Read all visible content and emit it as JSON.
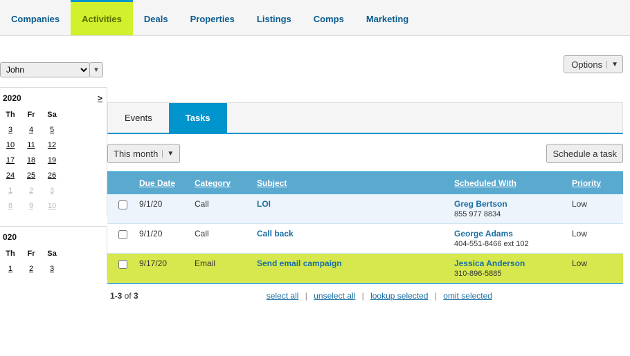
{
  "nav": {
    "items": [
      "Companies",
      "Activities",
      "Deals",
      "Properties",
      "Listings",
      "Comps",
      "Marketing"
    ],
    "active": 1
  },
  "user_selector": {
    "value": "John"
  },
  "options_button": "Options",
  "subtabs": {
    "items": [
      "Events",
      "Tasks"
    ],
    "active": 1
  },
  "filter": {
    "label": "This month"
  },
  "schedule_button": "Schedule a task",
  "grid": {
    "headers": {
      "due": "Due Date",
      "cat": "Category",
      "sub": "Subject",
      "sched": "Scheduled With",
      "pri": "Priority"
    },
    "rows": [
      {
        "due": "9/1/20",
        "cat": "Call",
        "sub": "LOI",
        "sched_name": "Greg Bertson",
        "sched_phone": "855 977 8834",
        "pri": "Low",
        "hl": false
      },
      {
        "due": "9/1/20",
        "cat": "Call",
        "sub": "Call back",
        "sched_name": "George Adams",
        "sched_phone": "404-551-8466 ext 102",
        "pri": "Low",
        "hl": false
      },
      {
        "due": "9/17/20",
        "cat": "Email",
        "sub": "Send email campaign",
        "sched_name": "Jessica Anderson",
        "sched_phone": "310-896-5885",
        "pri": "Low",
        "hl": true
      }
    ],
    "footer": {
      "count_prefix": "1-3",
      "count_mid": " of ",
      "count_suffix": "3",
      "select_all": "select all",
      "unselect_all": "unselect all",
      "lookup": "lookup selected",
      "omit": "omit selected"
    }
  },
  "calendar": {
    "year1": "2020",
    "next": ">",
    "dow": [
      "Th",
      "Fr",
      "Sa"
    ],
    "weeks1": [
      [
        "3",
        "4",
        "5"
      ],
      [
        "10",
        "11",
        "12"
      ],
      [
        "17",
        "18",
        "19"
      ],
      [
        "24",
        "25",
        "26"
      ]
    ],
    "overflow1": [
      [
        "1",
        "2",
        "3"
      ],
      [
        "8",
        "9",
        "10"
      ]
    ],
    "year2": "020",
    "dow2": [
      "Th",
      "Fr",
      "Sa"
    ],
    "weeks2": [
      [
        "1",
        "2",
        "3"
      ]
    ]
  }
}
